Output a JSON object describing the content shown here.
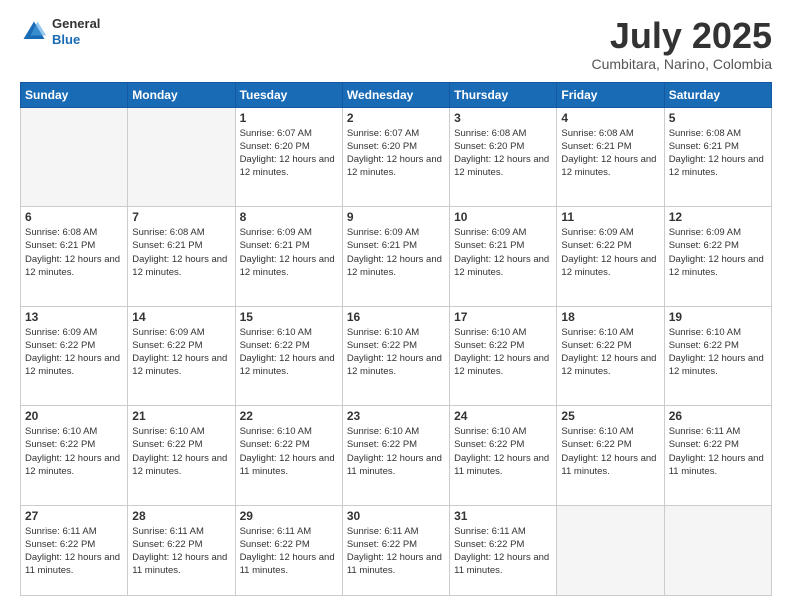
{
  "logo": {
    "general": "General",
    "blue": "Blue"
  },
  "header": {
    "month": "July 2025",
    "location": "Cumbitara, Narino, Colombia"
  },
  "weekdays": [
    "Sunday",
    "Monday",
    "Tuesday",
    "Wednesday",
    "Thursday",
    "Friday",
    "Saturday"
  ],
  "weeks": [
    [
      {
        "day": "",
        "empty": true
      },
      {
        "day": "",
        "empty": true
      },
      {
        "day": "1",
        "sunrise": "Sunrise: 6:07 AM",
        "sunset": "Sunset: 6:20 PM",
        "daylight": "Daylight: 12 hours and 12 minutes."
      },
      {
        "day": "2",
        "sunrise": "Sunrise: 6:07 AM",
        "sunset": "Sunset: 6:20 PM",
        "daylight": "Daylight: 12 hours and 12 minutes."
      },
      {
        "day": "3",
        "sunrise": "Sunrise: 6:08 AM",
        "sunset": "Sunset: 6:20 PM",
        "daylight": "Daylight: 12 hours and 12 minutes."
      },
      {
        "day": "4",
        "sunrise": "Sunrise: 6:08 AM",
        "sunset": "Sunset: 6:21 PM",
        "daylight": "Daylight: 12 hours and 12 minutes."
      },
      {
        "day": "5",
        "sunrise": "Sunrise: 6:08 AM",
        "sunset": "Sunset: 6:21 PM",
        "daylight": "Daylight: 12 hours and 12 minutes."
      }
    ],
    [
      {
        "day": "6",
        "sunrise": "Sunrise: 6:08 AM",
        "sunset": "Sunset: 6:21 PM",
        "daylight": "Daylight: 12 hours and 12 minutes."
      },
      {
        "day": "7",
        "sunrise": "Sunrise: 6:08 AM",
        "sunset": "Sunset: 6:21 PM",
        "daylight": "Daylight: 12 hours and 12 minutes."
      },
      {
        "day": "8",
        "sunrise": "Sunrise: 6:09 AM",
        "sunset": "Sunset: 6:21 PM",
        "daylight": "Daylight: 12 hours and 12 minutes."
      },
      {
        "day": "9",
        "sunrise": "Sunrise: 6:09 AM",
        "sunset": "Sunset: 6:21 PM",
        "daylight": "Daylight: 12 hours and 12 minutes."
      },
      {
        "day": "10",
        "sunrise": "Sunrise: 6:09 AM",
        "sunset": "Sunset: 6:21 PM",
        "daylight": "Daylight: 12 hours and 12 minutes."
      },
      {
        "day": "11",
        "sunrise": "Sunrise: 6:09 AM",
        "sunset": "Sunset: 6:22 PM",
        "daylight": "Daylight: 12 hours and 12 minutes."
      },
      {
        "day": "12",
        "sunrise": "Sunrise: 6:09 AM",
        "sunset": "Sunset: 6:22 PM",
        "daylight": "Daylight: 12 hours and 12 minutes."
      }
    ],
    [
      {
        "day": "13",
        "sunrise": "Sunrise: 6:09 AM",
        "sunset": "Sunset: 6:22 PM",
        "daylight": "Daylight: 12 hours and 12 minutes."
      },
      {
        "day": "14",
        "sunrise": "Sunrise: 6:09 AM",
        "sunset": "Sunset: 6:22 PM",
        "daylight": "Daylight: 12 hours and 12 minutes."
      },
      {
        "day": "15",
        "sunrise": "Sunrise: 6:10 AM",
        "sunset": "Sunset: 6:22 PM",
        "daylight": "Daylight: 12 hours and 12 minutes."
      },
      {
        "day": "16",
        "sunrise": "Sunrise: 6:10 AM",
        "sunset": "Sunset: 6:22 PM",
        "daylight": "Daylight: 12 hours and 12 minutes."
      },
      {
        "day": "17",
        "sunrise": "Sunrise: 6:10 AM",
        "sunset": "Sunset: 6:22 PM",
        "daylight": "Daylight: 12 hours and 12 minutes."
      },
      {
        "day": "18",
        "sunrise": "Sunrise: 6:10 AM",
        "sunset": "Sunset: 6:22 PM",
        "daylight": "Daylight: 12 hours and 12 minutes."
      },
      {
        "day": "19",
        "sunrise": "Sunrise: 6:10 AM",
        "sunset": "Sunset: 6:22 PM",
        "daylight": "Daylight: 12 hours and 12 minutes."
      }
    ],
    [
      {
        "day": "20",
        "sunrise": "Sunrise: 6:10 AM",
        "sunset": "Sunset: 6:22 PM",
        "daylight": "Daylight: 12 hours and 12 minutes."
      },
      {
        "day": "21",
        "sunrise": "Sunrise: 6:10 AM",
        "sunset": "Sunset: 6:22 PM",
        "daylight": "Daylight: 12 hours and 12 minutes."
      },
      {
        "day": "22",
        "sunrise": "Sunrise: 6:10 AM",
        "sunset": "Sunset: 6:22 PM",
        "daylight": "Daylight: 12 hours and 11 minutes."
      },
      {
        "day": "23",
        "sunrise": "Sunrise: 6:10 AM",
        "sunset": "Sunset: 6:22 PM",
        "daylight": "Daylight: 12 hours and 11 minutes."
      },
      {
        "day": "24",
        "sunrise": "Sunrise: 6:10 AM",
        "sunset": "Sunset: 6:22 PM",
        "daylight": "Daylight: 12 hours and 11 minutes."
      },
      {
        "day": "25",
        "sunrise": "Sunrise: 6:10 AM",
        "sunset": "Sunset: 6:22 PM",
        "daylight": "Daylight: 12 hours and 11 minutes."
      },
      {
        "day": "26",
        "sunrise": "Sunrise: 6:11 AM",
        "sunset": "Sunset: 6:22 PM",
        "daylight": "Daylight: 12 hours and 11 minutes."
      }
    ],
    [
      {
        "day": "27",
        "sunrise": "Sunrise: 6:11 AM",
        "sunset": "Sunset: 6:22 PM",
        "daylight": "Daylight: 12 hours and 11 minutes."
      },
      {
        "day": "28",
        "sunrise": "Sunrise: 6:11 AM",
        "sunset": "Sunset: 6:22 PM",
        "daylight": "Daylight: 12 hours and 11 minutes."
      },
      {
        "day": "29",
        "sunrise": "Sunrise: 6:11 AM",
        "sunset": "Sunset: 6:22 PM",
        "daylight": "Daylight: 12 hours and 11 minutes."
      },
      {
        "day": "30",
        "sunrise": "Sunrise: 6:11 AM",
        "sunset": "Sunset: 6:22 PM",
        "daylight": "Daylight: 12 hours and 11 minutes."
      },
      {
        "day": "31",
        "sunrise": "Sunrise: 6:11 AM",
        "sunset": "Sunset: 6:22 PM",
        "daylight": "Daylight: 12 hours and 11 minutes."
      },
      {
        "day": "",
        "empty": true
      },
      {
        "day": "",
        "empty": true
      }
    ]
  ]
}
